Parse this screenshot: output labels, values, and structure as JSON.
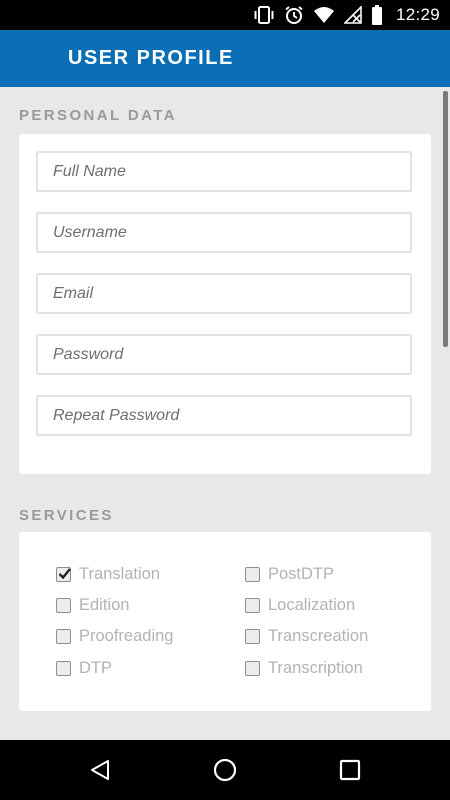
{
  "status_bar": {
    "time": "12:29",
    "icons": [
      "vibrate-icon",
      "alarm-icon",
      "wifi-icon",
      "no-signal-icon",
      "battery-icon"
    ]
  },
  "app_bar": {
    "title": "USER PROFILE",
    "color": "#0a6eb7"
  },
  "personal_data": {
    "title": "PERSONAL DATA",
    "fields": [
      {
        "placeholder": "Full Name",
        "value": ""
      },
      {
        "placeholder": "Username",
        "value": ""
      },
      {
        "placeholder": "Email",
        "value": ""
      },
      {
        "placeholder": "Password",
        "value": ""
      },
      {
        "placeholder": "Repeat Password",
        "value": ""
      }
    ]
  },
  "services": {
    "title": "SERVICES",
    "items": [
      {
        "label": "Translation",
        "checked": true
      },
      {
        "label": "Edition",
        "checked": false
      },
      {
        "label": "Proofreading",
        "checked": false
      },
      {
        "label": "DTP",
        "checked": false
      },
      {
        "label": "PostDTP",
        "checked": false
      },
      {
        "label": "Localization",
        "checked": false
      },
      {
        "label": "Transcreation",
        "checked": false
      },
      {
        "label": "Transcription",
        "checked": false
      }
    ]
  },
  "nav_bar": {
    "buttons": [
      "back-icon",
      "home-icon",
      "recents-icon"
    ]
  }
}
